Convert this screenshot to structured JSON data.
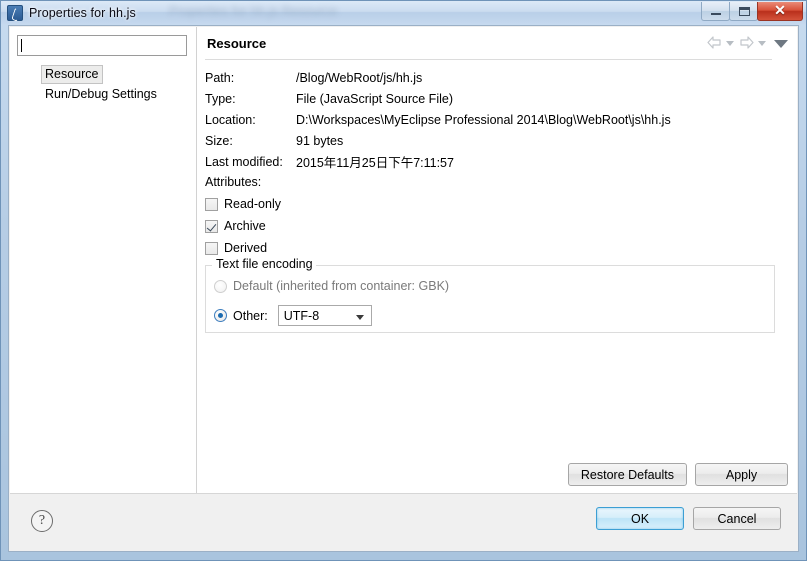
{
  "window": {
    "title": "Properties for hh.js",
    "ghost_title": "Properties for hh.js  Resource",
    "icon": "myeclipse-icon",
    "controls": {
      "minimize": "minimize-button",
      "maximize": "maximize-button",
      "close_glyph": "✕"
    }
  },
  "sidebar": {
    "filter": {
      "value": "",
      "placeholder": ""
    },
    "items": [
      {
        "label": "Resource",
        "selected": true
      },
      {
        "label": "Run/Debug Settings",
        "selected": false
      }
    ]
  },
  "main": {
    "title": "Resource",
    "toolbar": {
      "back": "back-arrow-icon",
      "back_menu": "chevron-down-icon",
      "forward": "forward-arrow-icon",
      "forward_menu": "chevron-down-icon",
      "view_menu": "view-menu-icon"
    },
    "properties": [
      {
        "label": "Path:",
        "value": "/Blog/WebRoot/js/hh.js"
      },
      {
        "label": "Type:",
        "value": "File   (JavaScript Source File)"
      },
      {
        "label": "Location:",
        "value": "D:\\Workspaces\\MyEclipse Professional 2014\\Blog\\WebRoot\\js\\hh.js"
      },
      {
        "label": "Size:",
        "value": "91   bytes"
      },
      {
        "label": "Last modified:",
        "value": "2015年11月25日下午7:11:57"
      }
    ],
    "attributes": {
      "title": "Attributes:",
      "items": [
        {
          "label": "Read-only",
          "checked": false
        },
        {
          "label": "Archive",
          "checked": true
        },
        {
          "label": "Derived",
          "checked": false
        }
      ]
    },
    "encoding": {
      "legend": "Text file encoding",
      "default_option": "Default (inherited from container: GBK)",
      "default_selected": false,
      "other_option": "Other:",
      "other_selected": true,
      "other_value": "UTF-8"
    },
    "buttons": {
      "restore_defaults": "Restore Defaults",
      "apply": "Apply"
    }
  },
  "footer": {
    "help": "?",
    "ok": "OK",
    "cancel": "Cancel"
  },
  "colors": {
    "accent": "#3c9fd4",
    "titlebar": "#cbdcf0",
    "close": "#b9301c"
  }
}
